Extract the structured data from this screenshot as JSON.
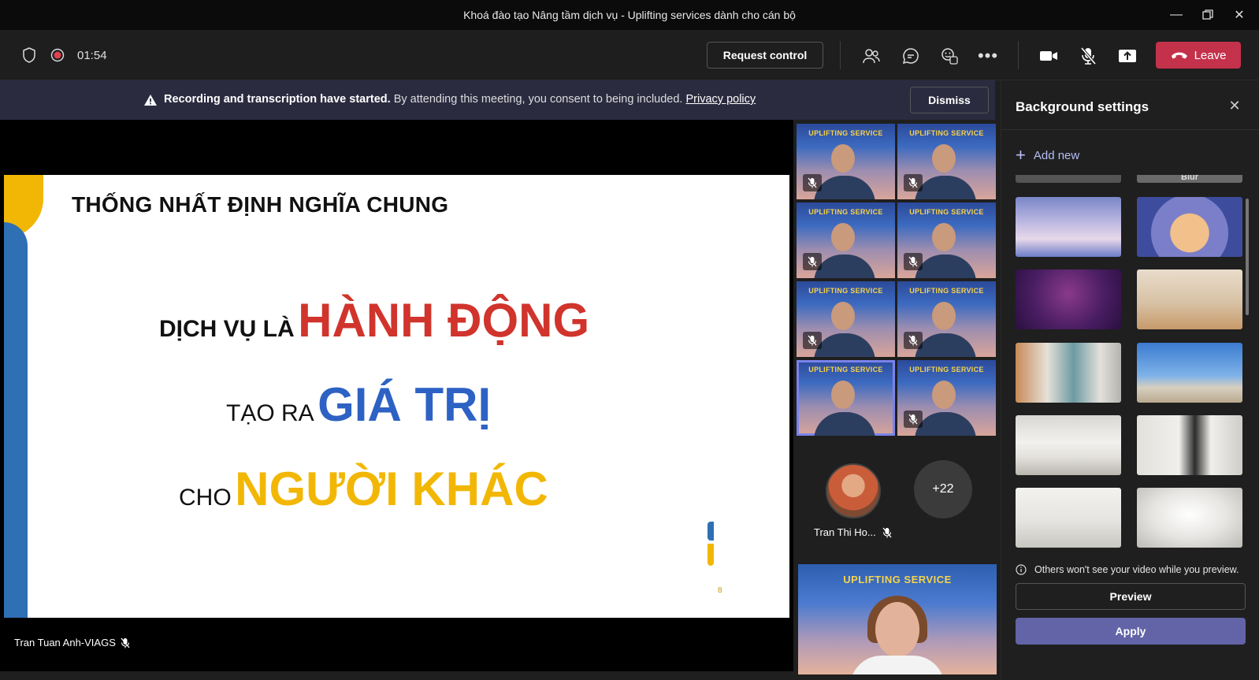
{
  "window": {
    "title": "Khoá đào tạo Nâng tầm dịch vụ - Uplifting services dành cho cán bộ",
    "controls": [
      "minimize-icon",
      "restore-icon",
      "close-icon"
    ]
  },
  "toolbar": {
    "timer": "01:54",
    "request_control_label": "Request control",
    "leave_label": "Leave",
    "icons": [
      "shield-icon",
      "recording-icon",
      "people-icon",
      "chat-icon",
      "reactions-icon",
      "more-icon",
      "camera-icon",
      "mic-off-icon",
      "share-icon",
      "phone-hangup-icon"
    ],
    "leave_color": "#c4314b"
  },
  "banner": {
    "bold_text": "Recording and transcription have started.",
    "text": "By attending this meeting, you consent to being included.",
    "link": "Privacy policy",
    "dismiss_label": "Dismiss"
  },
  "slide": {
    "title": "THỐNG NHẤT ĐỊNH NGHĨA CHUNG",
    "line1_small": "DỊCH VỤ LÀ",
    "line1_big": "HÀNH ĐỘNG",
    "line2_small": "TẠO RA",
    "line2_big": "GIÁ TRỊ",
    "line3_small": "CHO",
    "line3_big": "NGƯỜI KHÁC",
    "page_number": "8",
    "colors": {
      "red": "#d0342c",
      "blue": "#2d62c4",
      "yellow": "#f2b705"
    }
  },
  "presenter_name": "Tran Tuan Anh-VIAGS",
  "participants": {
    "tile_banner": "UPLIFTING SERVICE",
    "tile_count": 8,
    "avatar_name": "Tran Thi Ho...",
    "overflow_count": "+22"
  },
  "self_view": {
    "banner": "UPLIFTING SERVICE"
  },
  "background_panel": {
    "title": "Background settings",
    "add_new_label": "Add new",
    "blur_label": "Blur",
    "info_text": "Others won't see your video while you preview.",
    "preview_label": "Preview",
    "apply_label": "Apply",
    "accent": "#6264a7"
  }
}
